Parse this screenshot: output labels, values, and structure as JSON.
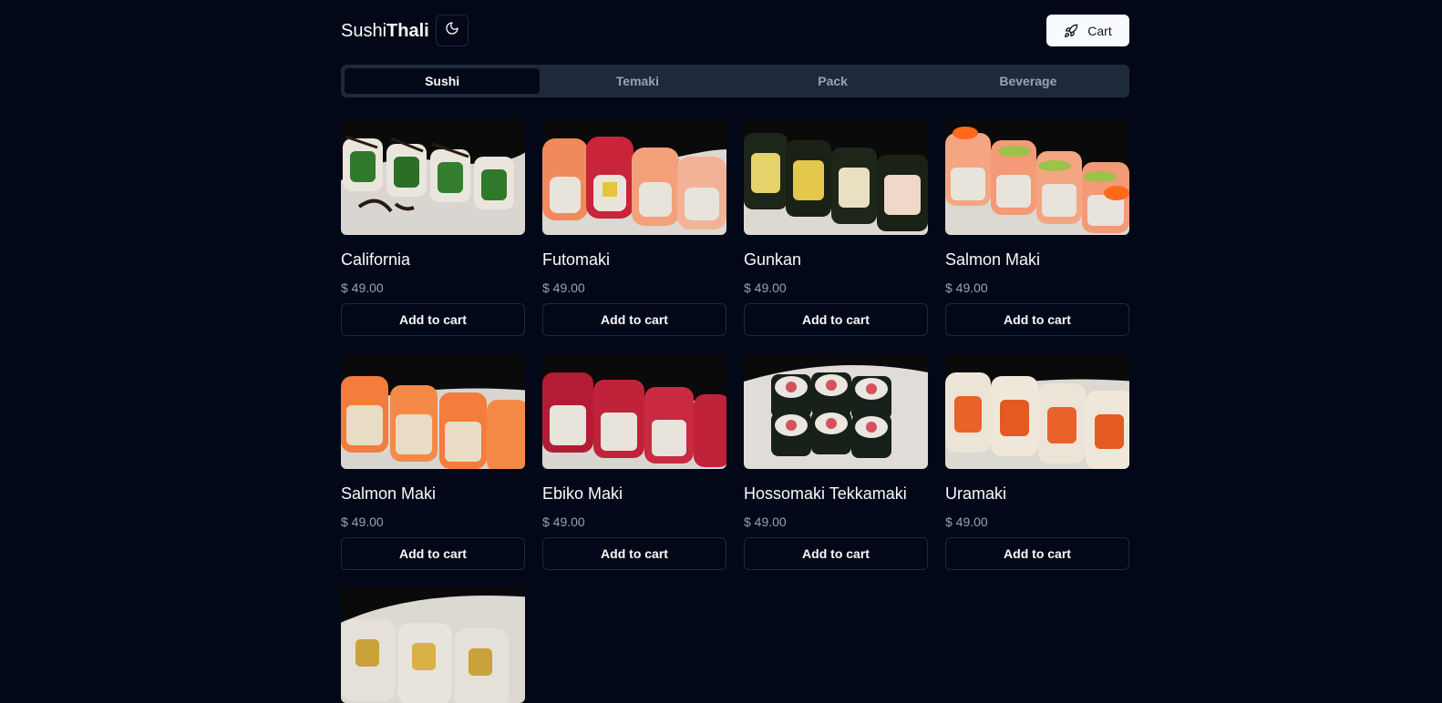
{
  "brand": {
    "light": "Sushi",
    "bold": "Thali"
  },
  "header": {
    "theme_toggle_icon": "moon-icon",
    "cart_label": "Cart",
    "cart_icon": "rocket-icon"
  },
  "tabs": [
    {
      "label": "Sushi",
      "active": true
    },
    {
      "label": "Temaki",
      "active": false
    },
    {
      "label": "Pack",
      "active": false
    },
    {
      "label": "Beverage",
      "active": false
    }
  ],
  "products": [
    {
      "name": "California",
      "price": "$ 49.00",
      "button": "Add to cart"
    },
    {
      "name": "Futomaki",
      "price": "$ 49.00",
      "button": "Add to cart"
    },
    {
      "name": "Gunkan",
      "price": "$ 49.00",
      "button": "Add to cart"
    },
    {
      "name": "Salmon Maki",
      "price": "$ 49.00",
      "button": "Add to cart"
    },
    {
      "name": "Salmon Maki",
      "price": "$ 49.00",
      "button": "Add to cart"
    },
    {
      "name": "Ebiko Maki",
      "price": "$ 49.00",
      "button": "Add to cart"
    },
    {
      "name": "Hossomaki Tekkamaki",
      "price": "$ 49.00",
      "button": "Add to cart"
    },
    {
      "name": "Uramaki",
      "price": "$ 49.00",
      "button": "Add to cart"
    },
    {
      "name": "",
      "price": "",
      "button": ""
    }
  ],
  "colors": {
    "background": "#020817",
    "foreground": "#f8fafc",
    "muted": "#94a3b8",
    "border": "#1e293b"
  }
}
